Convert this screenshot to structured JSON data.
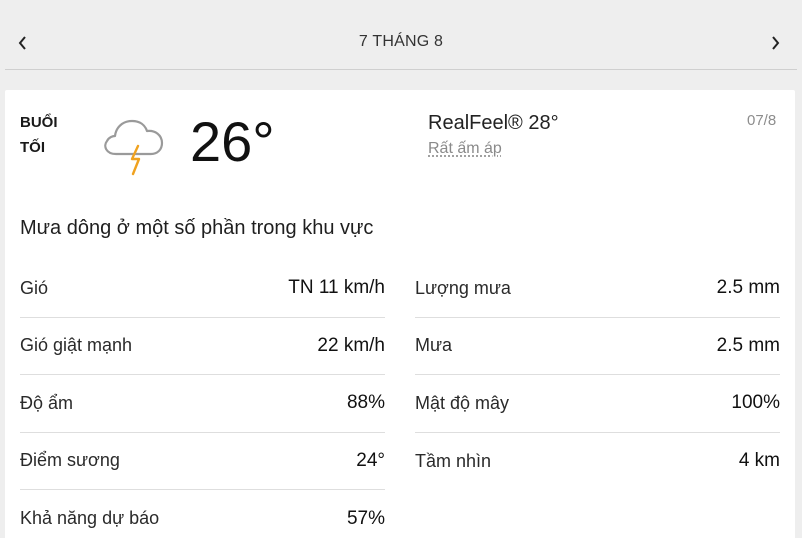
{
  "header": {
    "date_title": "7 THÁNG 8",
    "prev_icon": "chevron-left-icon",
    "next_icon": "chevron-right-icon"
  },
  "current": {
    "period_line1": "BUỔI",
    "period_line2": "TỐI",
    "icon": "thunderstorm-cloud-icon",
    "temperature": "26°",
    "realfeel": "RealFeel® 28°",
    "realfeel_phrase": "Rất ấm áp",
    "short_date": "07/8",
    "phrase": "Mưa dông ở một số phần trong khu vực"
  },
  "details_left": [
    {
      "label": "Gió",
      "value": "TN 11 km/h"
    },
    {
      "label": "Gió giật mạnh",
      "value": "22 km/h"
    },
    {
      "label": "Độ ẩm",
      "value": "88%"
    },
    {
      "label": "Điểm sương",
      "value": "24°"
    },
    {
      "label": "Khả năng dự báo",
      "value": "57%"
    }
  ],
  "details_right": [
    {
      "label": "Lượng mưa",
      "value": "2.5 mm"
    },
    {
      "label": "Mưa",
      "value": "2.5 mm"
    },
    {
      "label": "Mật độ mây",
      "value": "100%"
    },
    {
      "label": "Tầm nhìn",
      "value": "4 km"
    }
  ],
  "colors": {
    "background": "#eeeeee",
    "card": "#ffffff",
    "lightning": "#f0a21f",
    "muted_text": "#8a8a8a"
  }
}
